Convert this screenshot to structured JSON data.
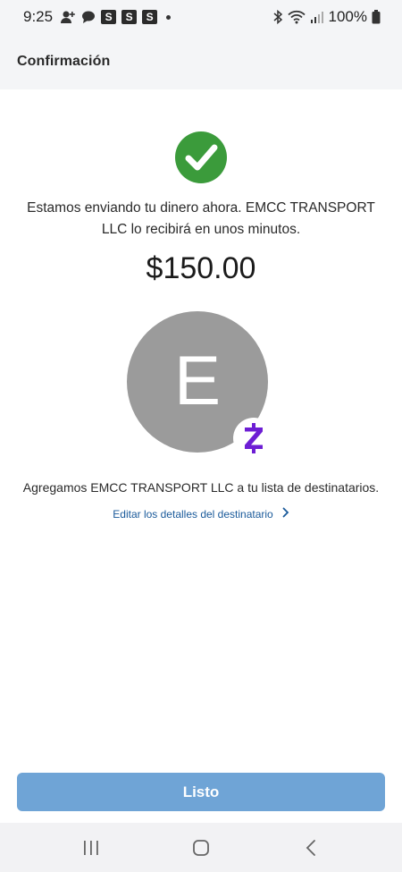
{
  "status_bar": {
    "time": "9:25",
    "badges": [
      "S",
      "S",
      "S"
    ],
    "battery": "100%",
    "icons": [
      "person-plus-icon",
      "chat-icon",
      "bluetooth-icon",
      "wifi-icon",
      "signal-icon",
      "battery-icon"
    ]
  },
  "header": {
    "title": "Confirmación"
  },
  "confirmation": {
    "message": "Estamos enviando tu dinero ahora. EMCC TRANSPORT LLC lo recibirá en unos minutos.",
    "amount": "$150.00",
    "avatar_letter": "E",
    "added_text": "Agregamos EMCC TRANSPORT LLC a tu lista de destinatarios.",
    "edit_link": "Editar los detalles del destinatario"
  },
  "done_button": {
    "label": "Listo"
  },
  "colors": {
    "success_green": "#3b9b3b",
    "zelle_purple": "#6d1ed4",
    "button_blue": "#6fa4d6",
    "link_blue": "#1a5a9a",
    "avatar_gray": "#9b9b9b"
  }
}
